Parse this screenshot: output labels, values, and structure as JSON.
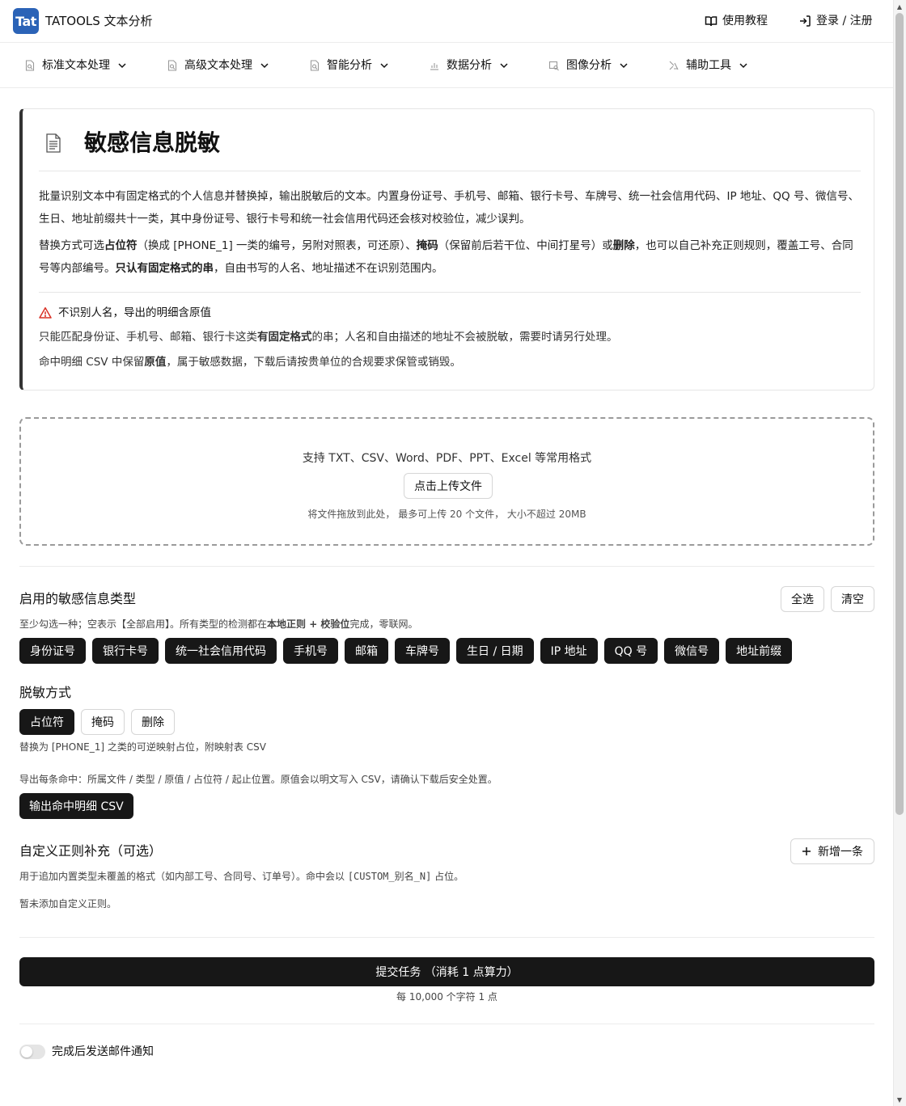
{
  "header": {
    "logo_text": "Tat",
    "brand": "TATOOLS 文本分析",
    "tutorial": "使用教程",
    "login": "登录 / 注册"
  },
  "nav": [
    {
      "label": "标准文本处理"
    },
    {
      "label": "高级文本处理"
    },
    {
      "label": "智能分析"
    },
    {
      "label": "数据分析"
    },
    {
      "label": "图像分析"
    },
    {
      "label": "辅助工具"
    }
  ],
  "card": {
    "title": "敏感信息脱敏",
    "p1": "批量识别文本中有固定格式的个人信息并替换掉，输出脱敏后的文本。内置身份证号、手机号、邮箱、银行卡号、车牌号、统一社会信用代码、IP 地址、QQ 号、微信号、生日、地址前缀共十一类，其中身份证号、银行卡号和统一社会信用代码还会核对校验位，减少误判。",
    "p2": {
      "a": "替换方式可选",
      "b": "占位符",
      "c": "（换成 [PHONE_1] 一类的编号，另附对照表，可还原）、",
      "d": "掩码",
      "e": "（保留前后若干位、中间打星号）或",
      "f": "删除",
      "g": "，也可以自己补充正则规则，覆盖工号、合同号等内部编号。",
      "h": "只认有固定格式的串",
      "i": "，自由书写的人名、地址描述不在识别范围内。"
    },
    "warning_title": "不识别人名，导出的明细含原值",
    "note1": {
      "a": "只能匹配身份证、手机号、邮箱、银行卡这类",
      "b": "有固定格式",
      "c": "的串；人名和自由描述的地址不会被脱敏，需要时请另行处理。"
    },
    "note2": {
      "a": "命中明细 CSV 中保留",
      "b": "原值",
      "c": "，属于敏感数据，下载后请按贵单位的合规要求保管或销毁。"
    }
  },
  "upload": {
    "formats": "支持 TXT、CSV、Word、PDF、PPT、Excel 等常用格式",
    "button": "点击上传文件",
    "hint": "将文件拖放到此处， 最多可上传 20 个文件， 大小不超过 20MB"
  },
  "types": {
    "title": "启用的敏感信息类型",
    "select_all": "全选",
    "clear": "清空",
    "help": {
      "a": "至少勾选一种；空表示【全部启用】。所有类型的检测都在",
      "b": "本地正则 + 校验位",
      "c": "完成，零联网。"
    },
    "chips": [
      "身份证号",
      "银行卡号",
      "统一社会信用代码",
      "手机号",
      "邮箱",
      "车牌号",
      "生日 / 日期",
      "IP 地址",
      "QQ 号",
      "微信号",
      "地址前缀"
    ]
  },
  "mode": {
    "title": "脱敏方式",
    "options": [
      "占位符",
      "掩码",
      "删除"
    ],
    "selected": "占位符",
    "help": "替换为 [PHONE_1] 之类的可逆映射占位，附映射表 CSV",
    "export_help": "导出每条命中：所属文件 / 类型 / 原值 / 占位符 / 起止位置。原值会以明文写入 CSV，请确认下载后安全处置。",
    "export_button": "输出命中明细 CSV"
  },
  "custom": {
    "title": "自定义正则补充（可选）",
    "add_button": "新增一条",
    "help_a": "用于追加内置类型未覆盖的格式（如内部工号、合同号、订单号）。命中会以 ",
    "help_code": "[CUSTOM_别名_N]",
    "help_b": " 占位。",
    "empty": "暂未添加自定义正则。"
  },
  "submit": {
    "label": "提交任务 （消耗 1 点算力）",
    "cost": "每 10,000 个字符 1 点"
  },
  "notify": {
    "label": "完成后发送邮件通知",
    "enabled": false
  }
}
